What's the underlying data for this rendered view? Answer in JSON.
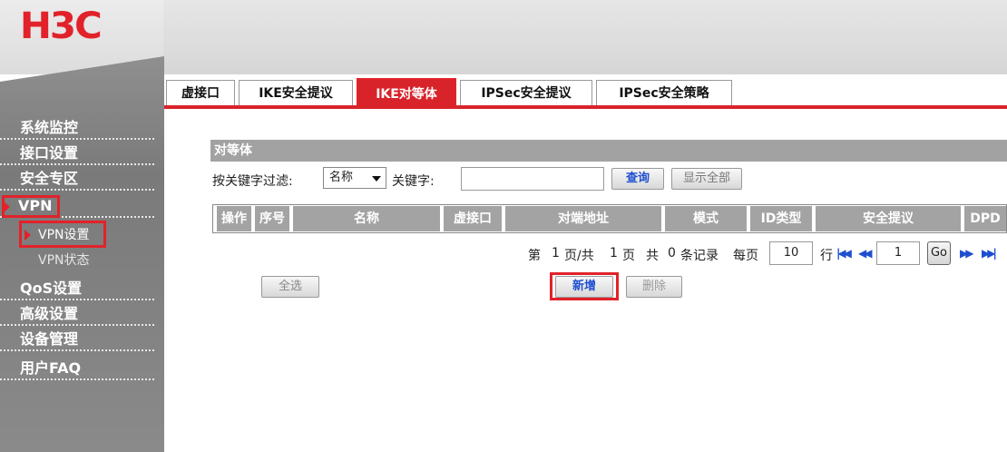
{
  "brand": {
    "logo_text": "H3C",
    "accent": "#e2222a"
  },
  "sidebar": {
    "items": [
      {
        "label": "系统监控"
      },
      {
        "label": "接口设置"
      },
      {
        "label": "安全专区"
      },
      {
        "label": "VPN"
      },
      {
        "label": "VPN设置"
      },
      {
        "label": "VPN状态"
      },
      {
        "label": "QoS设置"
      },
      {
        "label": "高级设置"
      },
      {
        "label": "设备管理"
      },
      {
        "label": "用户FAQ"
      }
    ]
  },
  "tabs": [
    {
      "label": "虚接口"
    },
    {
      "label": "IKE安全提议"
    },
    {
      "label": "IKE对等体",
      "active": true
    },
    {
      "label": "IPSec安全提议"
    },
    {
      "label": "IPSec安全策略"
    }
  ],
  "panel": {
    "title": "对等体",
    "filter_label": "按关键字过滤:",
    "filter_select_value": "名称",
    "keyword_label": "关键字:",
    "keyword_value": "",
    "query_button": "查询",
    "show_all_button": "显示全部"
  },
  "table": {
    "columns": [
      "操作",
      "序号",
      "名称",
      "虚接口",
      "对端地址",
      "模式",
      "ID类型",
      "安全提议",
      "DPD"
    ]
  },
  "pager": {
    "page_prefix": "第",
    "page_current": "1",
    "page_mid": "页/共",
    "page_total": "1",
    "page_suffix": "页",
    "total_prefix": "共",
    "total_records": "0",
    "total_suffix": "条记录",
    "per_page_label": "每页",
    "per_page_value": "10",
    "rows_label": "行",
    "jump_value": "1",
    "go_label": "Go"
  },
  "actions": {
    "select_all": "全选",
    "add": "新增",
    "delete": "删除"
  }
}
